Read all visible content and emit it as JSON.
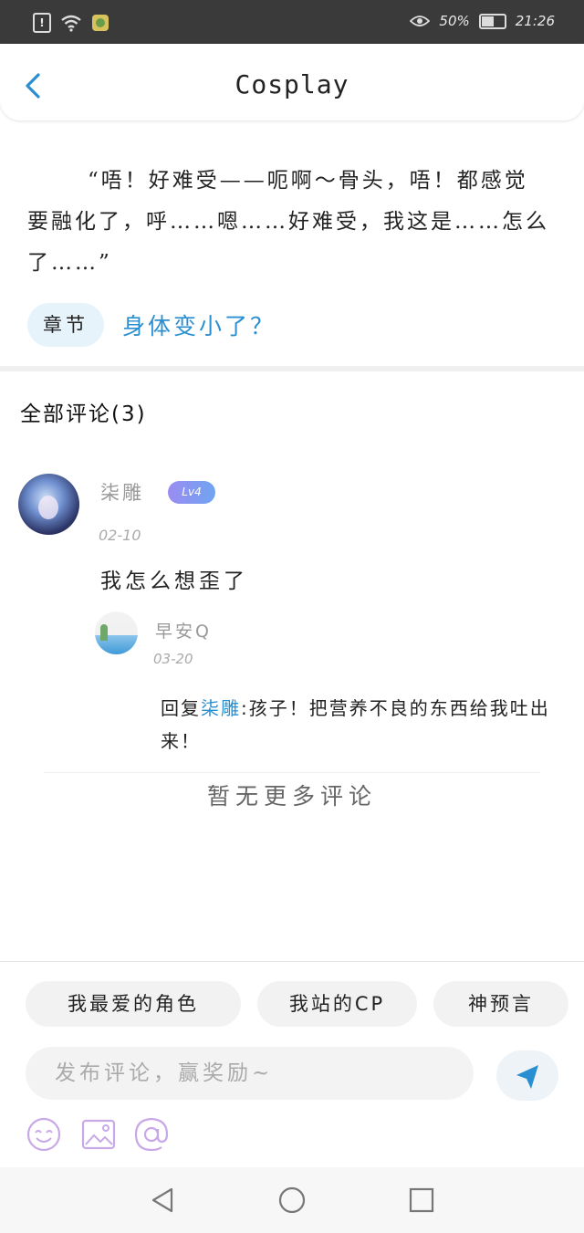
{
  "status_bar": {
    "battery_percent": "50%",
    "time": "21:26",
    "battery_level": 0.5
  },
  "header": {
    "title": "Cosplay"
  },
  "excerpt": {
    "text": "“唔！好难受——呃啊～骨头，唔！都感觉要融化了，呼……嗯……好难受，我这是……怎么了……”"
  },
  "chapter": {
    "tag": "章节",
    "title": "身体变小了？"
  },
  "comments": {
    "heading": "全部评论(3)",
    "items": [
      {
        "user": "柒雕",
        "level": "Lv4",
        "date": "02-10",
        "text": "我怎么想歪了",
        "replies": [
          {
            "user": "早安Q",
            "date": "03-20",
            "prefix": "回复",
            "mention": "柒雕",
            "text": ":孩子！把营养不良的东西给我吐出来！"
          }
        ]
      }
    ],
    "no_more": "暂无更多评论"
  },
  "composer": {
    "chips": [
      "我最爱的角色",
      "我站的CP",
      "神预言"
    ],
    "placeholder": "发布评论，赢奖励~",
    "accent_color": "#2a8fd1"
  }
}
